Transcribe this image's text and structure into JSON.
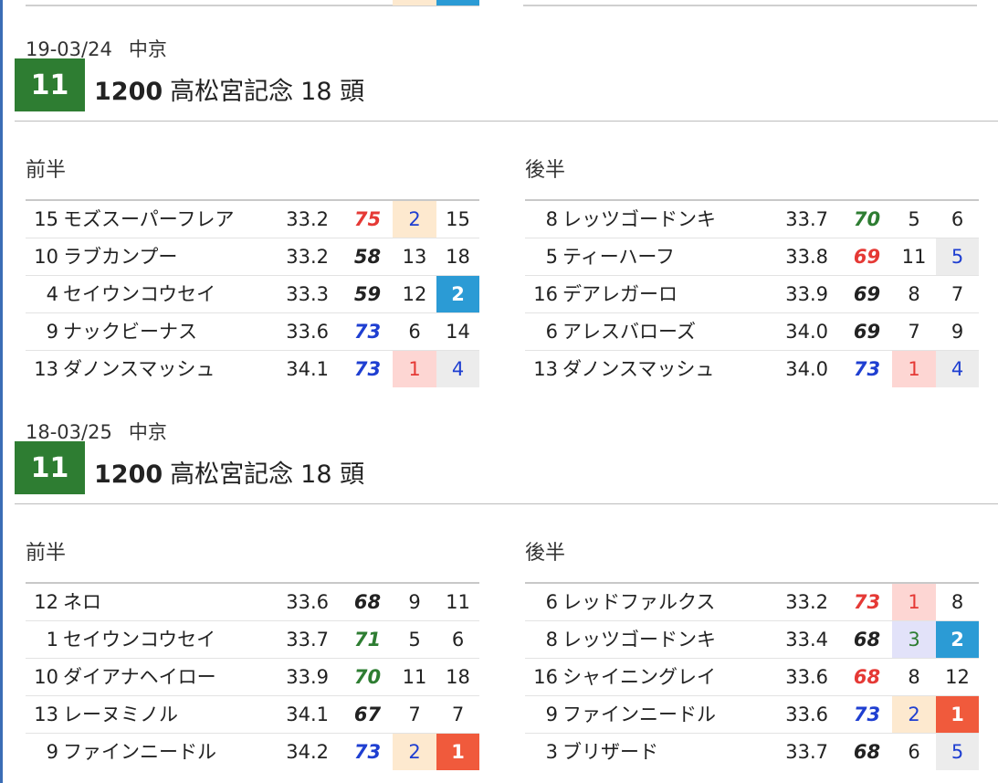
{
  "colors": {
    "race_number_bg": "#2e7d32",
    "score_red": "#e53935",
    "score_dark": "#222222",
    "score_green": "#2e7d32",
    "score_blue": "#1f3fd1",
    "rank_peach": "#fde9cf",
    "rank_pink": "#fdd6d3",
    "rank_lavender": "#e2e2f9",
    "rank_grey": "#ececec",
    "rank_blue_fill": "#2b9bd5",
    "rank_orange_fill": "#f05a3c",
    "text_red": "#e53935",
    "text_blue": "#1f3fd1"
  },
  "races": [
    {
      "date": "19-03/24",
      "venue": "中京",
      "race_number": "11",
      "distance": "1200",
      "race_name": "高松宮記念",
      "field_count": "18 頭",
      "halves": [
        {
          "label": "前半",
          "rows": [
            {
              "no": "15",
              "name": "モズスーパーフレア",
              "time": "33.2",
              "score": "75",
              "score_color": "red",
              "pos1": "2",
              "pos1_style": "peach-blue",
              "pos2": "15",
              "pos2_style": "plain"
            },
            {
              "no": "10",
              "name": "ラブカンプー",
              "time": "33.2",
              "score": "58",
              "score_color": "dark",
              "pos1": "13",
              "pos1_style": "plain",
              "pos2": "18",
              "pos2_style": "plain"
            },
            {
              "no": "4",
              "name": "セイウンコウセイ",
              "time": "33.3",
              "score": "59",
              "score_color": "dark",
              "pos1": "12",
              "pos1_style": "plain",
              "pos2": "2",
              "pos2_style": "blue-fill"
            },
            {
              "no": "9",
              "name": "ナックビーナス",
              "time": "33.6",
              "score": "73",
              "score_color": "blue",
              "pos1": "6",
              "pos1_style": "plain",
              "pos2": "14",
              "pos2_style": "plain"
            },
            {
              "no": "13",
              "name": "ダノンスマッシュ",
              "time": "34.1",
              "score": "73",
              "score_color": "blue",
              "pos1": "1",
              "pos1_style": "pink-red",
              "pos2": "4",
              "pos2_style": "grey-blue"
            }
          ]
        },
        {
          "label": "後半",
          "rows": [
            {
              "no": "8",
              "name": "レッツゴードンキ",
              "time": "33.7",
              "score": "70",
              "score_color": "green",
              "pos1": "5",
              "pos1_style": "plain",
              "pos2": "6",
              "pos2_style": "plain"
            },
            {
              "no": "5",
              "name": "ティーハーフ",
              "time": "33.8",
              "score": "69",
              "score_color": "red",
              "pos1": "11",
              "pos1_style": "plain",
              "pos2": "5",
              "pos2_style": "grey-blue"
            },
            {
              "no": "16",
              "name": "デアレガーロ",
              "time": "33.9",
              "score": "69",
              "score_color": "dark",
              "pos1": "8",
              "pos1_style": "plain",
              "pos2": "7",
              "pos2_style": "plain"
            },
            {
              "no": "6",
              "name": "アレスバローズ",
              "time": "34.0",
              "score": "69",
              "score_color": "dark",
              "pos1": "7",
              "pos1_style": "plain",
              "pos2": "9",
              "pos2_style": "plain"
            },
            {
              "no": "13",
              "name": "ダノンスマッシュ",
              "time": "34.0",
              "score": "73",
              "score_color": "blue",
              "pos1": "1",
              "pos1_style": "pink-red",
              "pos2": "4",
              "pos2_style": "grey-blue"
            }
          ]
        }
      ]
    },
    {
      "date": "18-03/25",
      "venue": "中京",
      "race_number": "11",
      "distance": "1200",
      "race_name": "高松宮記念",
      "field_count": "18 頭",
      "halves": [
        {
          "label": "前半",
          "rows": [
            {
              "no": "12",
              "name": "ネロ",
              "time": "33.6",
              "score": "68",
              "score_color": "dark",
              "pos1": "9",
              "pos1_style": "plain",
              "pos2": "11",
              "pos2_style": "plain"
            },
            {
              "no": "1",
              "name": "セイウンコウセイ",
              "time": "33.7",
              "score": "71",
              "score_color": "green",
              "pos1": "5",
              "pos1_style": "plain",
              "pos2": "6",
              "pos2_style": "plain"
            },
            {
              "no": "10",
              "name": "ダイアナヘイロー",
              "time": "33.9",
              "score": "70",
              "score_color": "green",
              "pos1": "11",
              "pos1_style": "plain",
              "pos2": "18",
              "pos2_style": "plain"
            },
            {
              "no": "13",
              "name": "レーヌミノル",
              "time": "34.1",
              "score": "67",
              "score_color": "dark",
              "pos1": "7",
              "pos1_style": "plain",
              "pos2": "7",
              "pos2_style": "plain"
            },
            {
              "no": "9",
              "name": "ファインニードル",
              "time": "34.2",
              "score": "73",
              "score_color": "blue",
              "pos1": "2",
              "pos1_style": "peach-blue",
              "pos2": "1",
              "pos2_style": "orange-fill"
            }
          ]
        },
        {
          "label": "後半",
          "rows": [
            {
              "no": "6",
              "name": "レッドファルクス",
              "time": "33.2",
              "score": "73",
              "score_color": "red",
              "pos1": "1",
              "pos1_style": "pink-red",
              "pos2": "8",
              "pos2_style": "plain"
            },
            {
              "no": "8",
              "name": "レッツゴードンキ",
              "time": "33.4",
              "score": "68",
              "score_color": "dark",
              "pos1": "3",
              "pos1_style": "lavender-green",
              "pos2": "2",
              "pos2_style": "blue-fill"
            },
            {
              "no": "16",
              "name": "シャイニングレイ",
              "time": "33.6",
              "score": "68",
              "score_color": "red",
              "pos1": "8",
              "pos1_style": "plain",
              "pos2": "12",
              "pos2_style": "plain"
            },
            {
              "no": "9",
              "name": "ファインニードル",
              "time": "33.6",
              "score": "73",
              "score_color": "blue",
              "pos1": "2",
              "pos1_style": "peach-blue",
              "pos2": "1",
              "pos2_style": "orange-fill"
            },
            {
              "no": "3",
              "name": "ブリザード",
              "time": "33.7",
              "score": "68",
              "score_color": "dark",
              "pos1": "6",
              "pos1_style": "plain",
              "pos2": "5",
              "pos2_style": "grey-blue"
            }
          ]
        }
      ]
    }
  ]
}
